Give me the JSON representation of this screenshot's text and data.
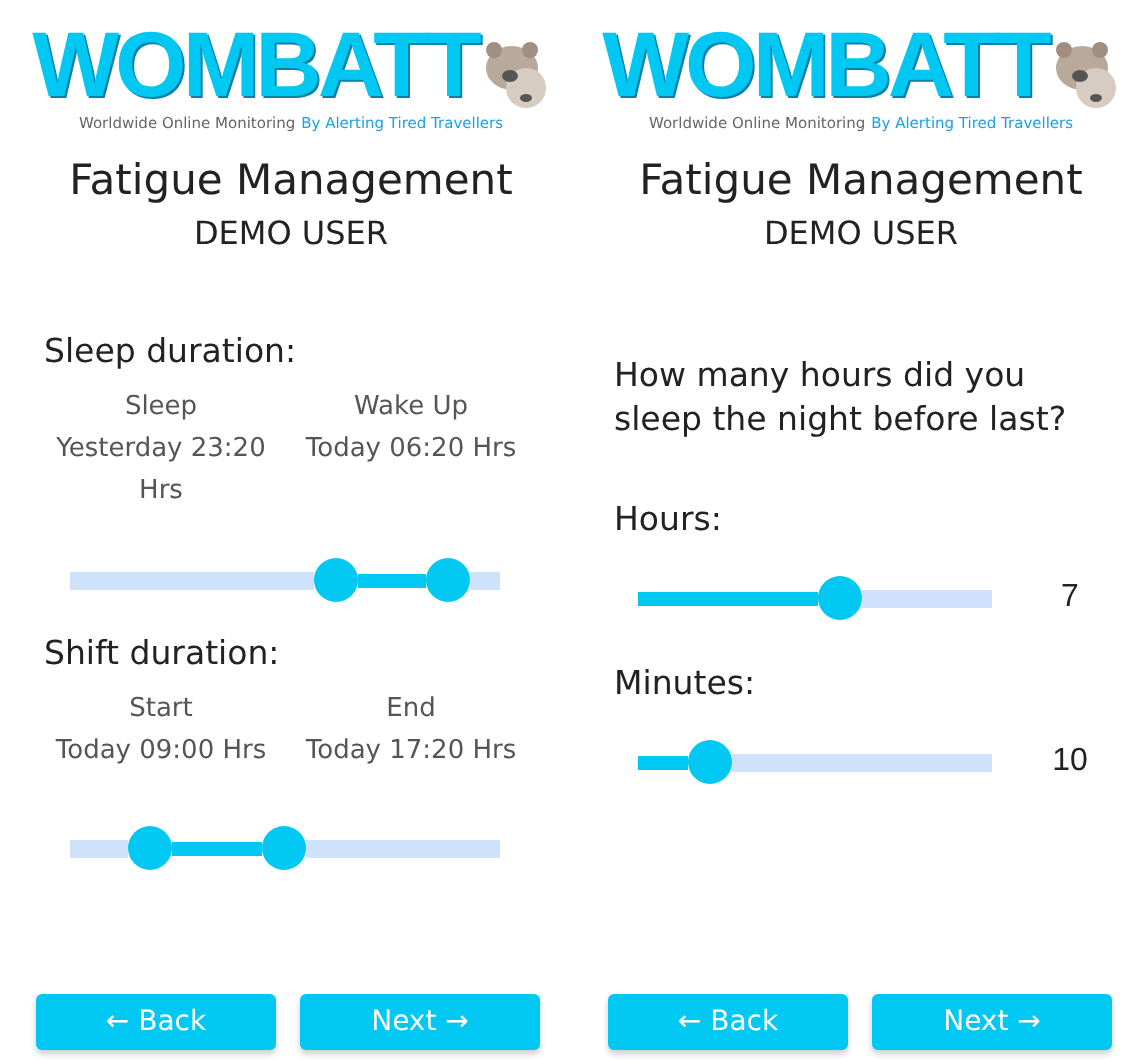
{
  "screens": [
    {
      "kind": "ranges",
      "logo": {
        "wordmark": "WOMBATT",
        "tagline": "Worldwide Online Monitoring",
        "tagline_highlight": "By Alerting Tired Travellers"
      },
      "title": "Fatigue Management",
      "user": "DEMO USER",
      "sections": [
        {
          "heading": "Sleep duration:",
          "columns": [
            {
              "label": "Sleep",
              "value": "Yesterday 23:20 Hrs"
            },
            {
              "label": "Wake Up",
              "value": "Today 06:20 Hrs"
            }
          ],
          "handles": [
            {
              "level": 0.63
            },
            {
              "level": 0.92
            }
          ]
        },
        {
          "heading": "Shift duration:",
          "columns": [
            {
              "label": "Start",
              "value": "Today 09:00 Hrs"
            },
            {
              "label": "End",
              "value": "Today 17:20 Hrs"
            }
          ],
          "handles": [
            {
              "level": 0.15
            },
            {
              "level": 0.5
            }
          ]
        }
      ],
      "buttons": [
        "← Back",
        "Next →"
      ]
    },
    {
      "kind": "question",
      "logo": {
        "wordmark": "WOMBATT",
        "tagline": "Worldwide Online Monitoring",
        "tagline_highlight": "By Alerting Tired Travellers"
      },
      "title": "Fatigue Management",
      "user": "DEMO USER",
      "question": "How many hours did you sleep the night before last?",
      "sliders": [
        {
          "label": "Hours:",
          "level": 0.58,
          "reading": "7"
        },
        {
          "label": "Minutes:",
          "level": 0.16,
          "reading": "10"
        }
      ],
      "buttons": [
        "← Back",
        "Next →"
      ]
    }
  ]
}
